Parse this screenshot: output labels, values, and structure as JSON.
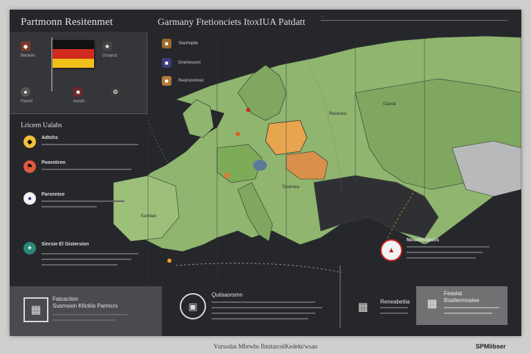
{
  "header": {
    "left_title": "Partmonn Resitenmet",
    "main_title": "Garmany Ftetionciets ItoxIUA Patdatt",
    "subtitle": "..."
  },
  "top_panel": {
    "flag_label": "Germany flag",
    "items": [
      {
        "icon": "shield-icon",
        "text": "Bertelm"
      },
      {
        "icon": "badge-icon",
        "text": "Grnanst"
      },
      {
        "icon": "helmet-icon",
        "text": "Pasmt"
      },
      {
        "icon": "tank-icon",
        "text": "Aviotn"
      }
    ]
  },
  "legend_top": [
    {
      "label": "Stanhoplie",
      "color": "#f0a020"
    },
    {
      "label": "Dnertessom",
      "color": "#3a3f7a"
    },
    {
      "label": "Reoirvonmsin",
      "color": "#e0a050"
    }
  ],
  "side": {
    "section_title": "Lricern Ualabs",
    "items": [
      {
        "icon": "shield-icon",
        "title": "Adtshs"
      },
      {
        "icon": "flag-icon",
        "title": "Pooreiiren"
      },
      {
        "icon": "lock-icon",
        "title": "Parsnnise"
      },
      {
        "icon": "circle-icon",
        "title": "Sinrsie El Gistersion"
      }
    ]
  },
  "map_labels": {
    "north_region": "Recinasa",
    "east_region": "Giarrat",
    "west_region": "Eantdan",
    "south_region": "Toratniea"
  },
  "marker_right": {
    "title": "Nosctestiasiis",
    "icon": "helmet-icon"
  },
  "bottom": {
    "left_title": "Fatcaction",
    "left_line": "Susmsion Kfictiiis Parmcrs",
    "center_title": "Quiisaorsmn",
    "right_title": "Reneabetiia",
    "right_box_title": "Feaslat",
    "right_box_line": "Bostlermnaiee"
  },
  "caption": "Vursodas Mbrwhs IbnitarcnlKedekt/wsan",
  "brand": "SPMlibser",
  "colors": {
    "land_green": "#8fb56e",
    "land_green_dark": "#6e9b54",
    "sea": "#262729",
    "highlight_orange": "#e8a54f",
    "accent_red": "#cc2a22"
  }
}
